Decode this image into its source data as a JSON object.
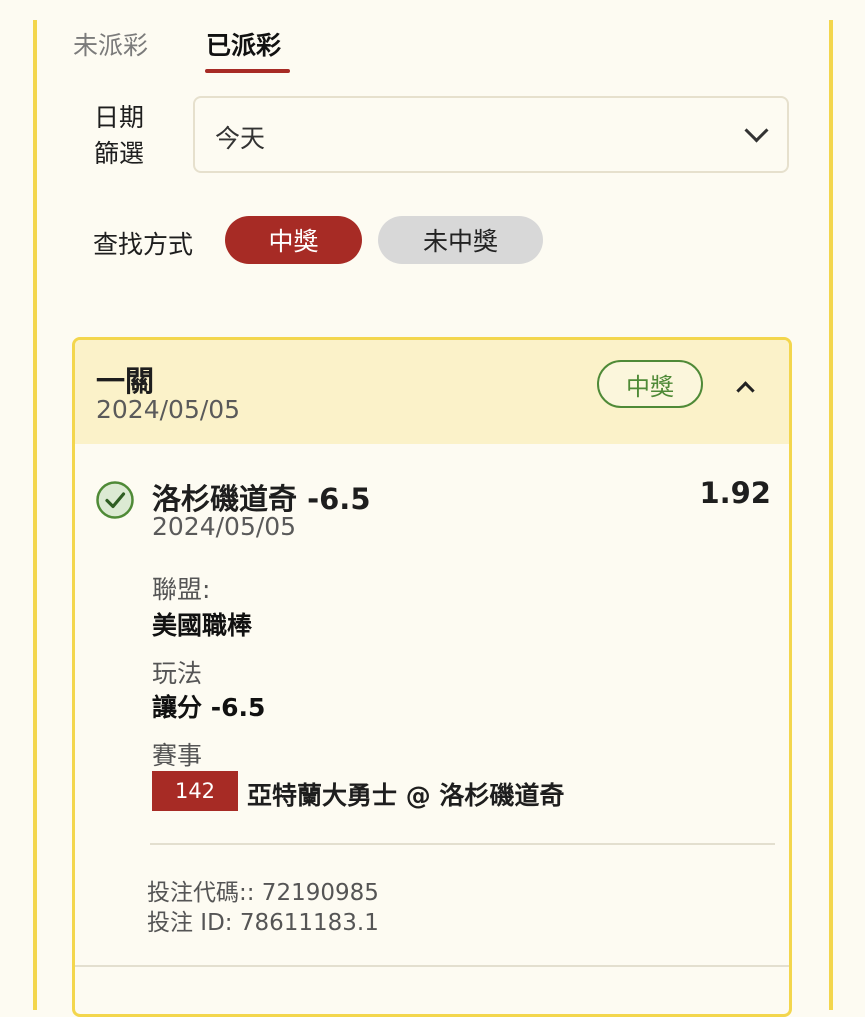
{
  "tabs": {
    "unpaid": "未派彩",
    "paid": "已派彩"
  },
  "filter": {
    "date_label": "日期篩選",
    "date_value": "今天",
    "search_label": "查找方式",
    "win_option": "中獎",
    "lose_option": "未中獎"
  },
  "bet_card": {
    "type": "一關",
    "date": "2024/05/05",
    "result_badge": "中獎",
    "selection": {
      "name": "洛杉磯道奇 -6.5",
      "odds": "1.92",
      "date": "2024/05/05",
      "league_label": "聯盟:",
      "league_value": "美國職棒",
      "bet_type_label": "玩法",
      "bet_type_value": "讓分 -6.5",
      "match_label": "賽事",
      "match_number": "142",
      "match_name": "亞特蘭大勇士 @ 洛杉磯道奇"
    },
    "bet_code": "投注代碼:: 72190985",
    "bet_id": "投注 ID: 78611183.1"
  },
  "colors": {
    "accent": "#a72b25",
    "border": "#f3d64d",
    "win": "#4f8a37",
    "header_bg": "#fbf2c9",
    "page_bg": "#fdfbf2"
  }
}
